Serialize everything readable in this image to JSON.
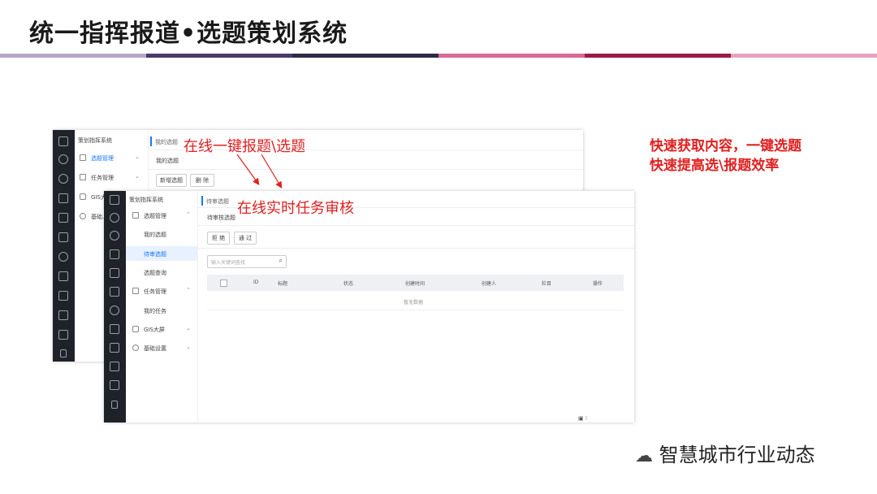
{
  "slide": {
    "title": "统一指挥报道•选题策划系统",
    "stripe_colors": [
      "#b9a7c9",
      "#4b3a6b",
      "#2f2b45",
      "#d86a95",
      "#9c1c47",
      "#e5a3be"
    ]
  },
  "annotations": {
    "label1": "在线一键报题\\选题",
    "label2": "在线实时任务审核",
    "side_line1": "快速获取内容，一键选题",
    "side_line2": "快速提高选\\报题效率"
  },
  "screen1": {
    "app_title": "策划指挥系统",
    "tab": "我的选题",
    "breadcrumb": "我的选题",
    "btn_new": "新增选题",
    "btn_delete": "删 除",
    "nav": [
      {
        "label": "选题管理"
      },
      {
        "label": "任务管理"
      },
      {
        "label": "GIS大..."
      },
      {
        "label": "基础..."
      }
    ]
  },
  "screen2": {
    "app_title": "策划指挥系统",
    "tab": "待审选题",
    "breadcrumb": "待审核选题",
    "btn_reject": "拒 绝",
    "btn_pass": "通 过",
    "search_placeholder": "输入关键词查找",
    "nav": [
      {
        "label": "选题管理"
      },
      {
        "label": "我的选题"
      },
      {
        "label": "待审选题"
      },
      {
        "label": "选题查询"
      },
      {
        "label": "任务管理"
      },
      {
        "label": "我的任务"
      },
      {
        "label": "GIS大屏"
      },
      {
        "label": "基础设置"
      }
    ],
    "table_headers": [
      "ID",
      "标题",
      "状态",
      "创建时间",
      "创建人",
      "栏目",
      "操作"
    ],
    "empty_text": "暂无数据"
  },
  "watermark": "智慧城市行业动态",
  "colors": {
    "accent": "#1677ff",
    "annotation": "#e02020"
  }
}
